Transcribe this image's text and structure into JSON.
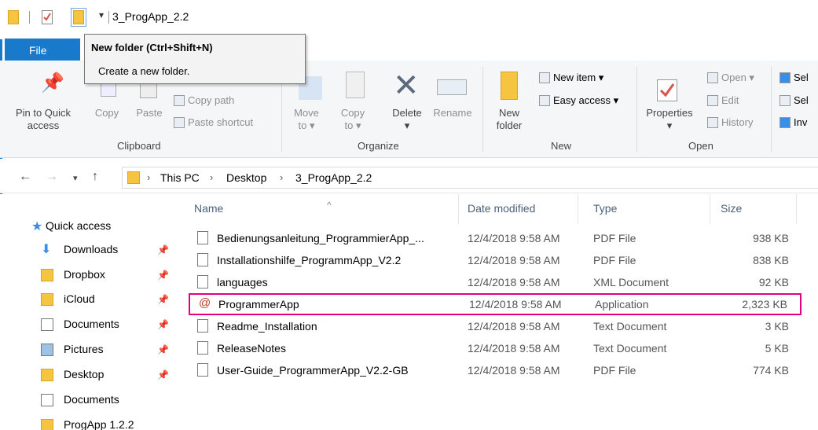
{
  "window": {
    "title": "3_ProgApp_2.2"
  },
  "ribbon": {
    "file_tab": "File",
    "clipboard": {
      "pin_line1": "Pin to Quick",
      "pin_line2": "access",
      "copy": "Copy",
      "paste": "Paste",
      "copy_path": "Copy path",
      "paste_shortcut": "Paste shortcut",
      "group": "Clipboard"
    },
    "organize": {
      "move_line1": "Move",
      "move_line2": "to ▾",
      "copy_line1": "Copy",
      "copy_line2": "to ▾",
      "delete": "Delete",
      "delete_arrow": "▾",
      "rename": "Rename",
      "group": "Organize"
    },
    "new": {
      "new_folder_line1": "New",
      "new_folder_line2": "folder",
      "new_item": "New item ▾",
      "easy_access": "Easy access ▾",
      "group": "New"
    },
    "open": {
      "properties": "Properties",
      "properties_arrow": "▾",
      "open": "Open ▾",
      "edit": "Edit",
      "history": "History",
      "group": "Open"
    },
    "select": {
      "sel1": "Sel",
      "sel2": "Sel",
      "inv": "Inv"
    }
  },
  "tooltip": {
    "title": "New folder (Ctrl+Shift+N)",
    "body": "Create a new folder."
  },
  "address": {
    "crumbs": [
      "This PC",
      "Desktop",
      "3_ProgApp_2.2"
    ]
  },
  "nav": {
    "items": [
      {
        "label": "Quick access",
        "icon": "star-icon"
      },
      {
        "label": "Downloads",
        "icon": "download-icon",
        "pinned": true
      },
      {
        "label": "Dropbox",
        "icon": "folder-icon",
        "pinned": true
      },
      {
        "label": "iCloud",
        "icon": "folder-icon",
        "pinned": true
      },
      {
        "label": "Documents",
        "icon": "documents-icon",
        "pinned": true
      },
      {
        "label": "Pictures",
        "icon": "pictures-icon",
        "pinned": true
      },
      {
        "label": "Desktop",
        "icon": "folder-icon",
        "pinned": true
      },
      {
        "label": "Documents",
        "icon": "documents-icon"
      },
      {
        "label": "ProgApp 1.2.2",
        "icon": "folder-icon"
      }
    ]
  },
  "list": {
    "columns": {
      "name": "Name",
      "date": "Date modified",
      "type": "Type",
      "size": "Size"
    },
    "rows": [
      {
        "name": "Bedienungsanleitung_ProgrammierApp_...",
        "date": "12/4/2018 9:58 AM",
        "type": "PDF File",
        "size": "938 KB",
        "icon": "pdf-icon"
      },
      {
        "name": "Installationshilfe_ProgrammApp_V2.2",
        "date": "12/4/2018 9:58 AM",
        "type": "PDF File",
        "size": "838 KB",
        "icon": "pdf-icon"
      },
      {
        "name": "languages",
        "date": "12/4/2018 9:58 AM",
        "type": "XML Document",
        "size": "92 KB",
        "icon": "xml-icon"
      },
      {
        "name": "ProgrammerApp",
        "date": "12/4/2018 9:58 AM",
        "type": "Application",
        "size": "2,323 KB",
        "icon": "app-icon",
        "selected": true
      },
      {
        "name": "Readme_Installation",
        "date": "12/4/2018 9:58 AM",
        "type": "Text Document",
        "size": "3 KB",
        "icon": "text-icon"
      },
      {
        "name": "ReleaseNotes",
        "date": "12/4/2018 9:58 AM",
        "type": "Text Document",
        "size": "5 KB",
        "icon": "text-icon"
      },
      {
        "name": "User-Guide_ProgrammerApp_V2.2-GB",
        "date": "12/4/2018 9:58 AM",
        "type": "PDF File",
        "size": "774 KB",
        "icon": "pdf-icon"
      }
    ]
  },
  "colors": {
    "accent": "#1979ca",
    "folder": "#f5c542",
    "highlight": "#e0007f",
    "header_text": "#4c607a"
  }
}
